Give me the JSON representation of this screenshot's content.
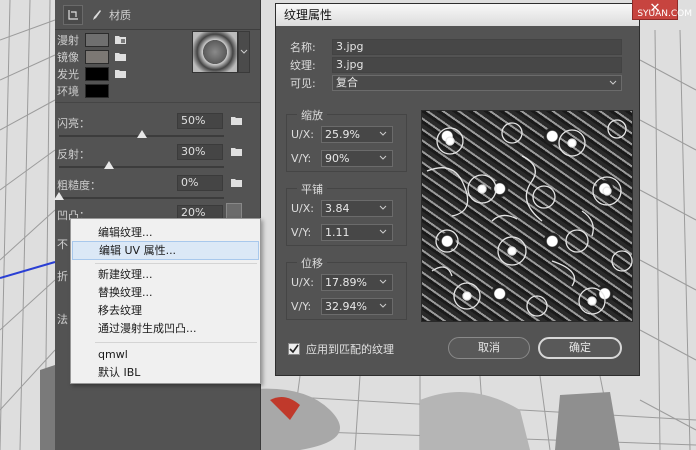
{
  "props": {
    "tab_label": "材质",
    "materials": [
      {
        "label": "漫射",
        "color": "#6f6f6f"
      },
      {
        "label": "镜像",
        "color": "#7c7874"
      },
      {
        "label": "发光",
        "color": "#000000"
      },
      {
        "label": "环境",
        "color": "#000000"
      }
    ],
    "sliders": [
      {
        "label": "闪亮：",
        "value": "50%",
        "level": 0.5
      },
      {
        "label": "反射：",
        "value": "30%",
        "level": 0.3
      },
      {
        "label": "粗糙度：",
        "value": "0%",
        "level": 0.0
      },
      {
        "label": "凹凸：",
        "value": "20%",
        "level": 0.2
      }
    ],
    "clipped_labels": [
      "不",
      "折",
      "法"
    ]
  },
  "context_menu": {
    "items": [
      "编辑纹理...",
      "编辑 UV 属性...",
      "新建纹理...",
      "替换纹理...",
      "移去纹理",
      "通过漫射生成凹凸...",
      "qmwl",
      "默认 IBL"
    ],
    "highlighted_index": 1
  },
  "dialog": {
    "title": "纹理属性",
    "name_label": "名称:",
    "name_value": "3.jpg",
    "texture_label": "纹理:",
    "texture_value": "3.jpg",
    "visible_label": "可见:",
    "visible_value": "复合",
    "scale": {
      "title": "缩放",
      "u_label": "U/X:",
      "u_value": "25.9%",
      "v_label": "V/Y:",
      "v_value": "90%"
    },
    "tile": {
      "title": "平铺",
      "u_label": "U/X:",
      "u_value": "3.84",
      "v_label": "V/Y:",
      "v_value": "1.11"
    },
    "offset": {
      "title": "位移",
      "u_label": "U/X:",
      "u_value": "17.89%",
      "v_label": "V/Y:",
      "v_value": "32.94%"
    },
    "apply_label": "应用到匹配的纹理",
    "apply_checked": true,
    "cancel_label": "取消",
    "ok_label": "确定",
    "close_glyph": "✕"
  },
  "watermark": "SYUAN.COM",
  "colors": {
    "panel": "#535353",
    "dialog": "#5b5b5b",
    "menu": "#f0f0f0",
    "highlight": "#dbe8f6",
    "close": "#c7443f",
    "axis_x": "#2a3fd4",
    "axis_y": "#d42a2a"
  }
}
